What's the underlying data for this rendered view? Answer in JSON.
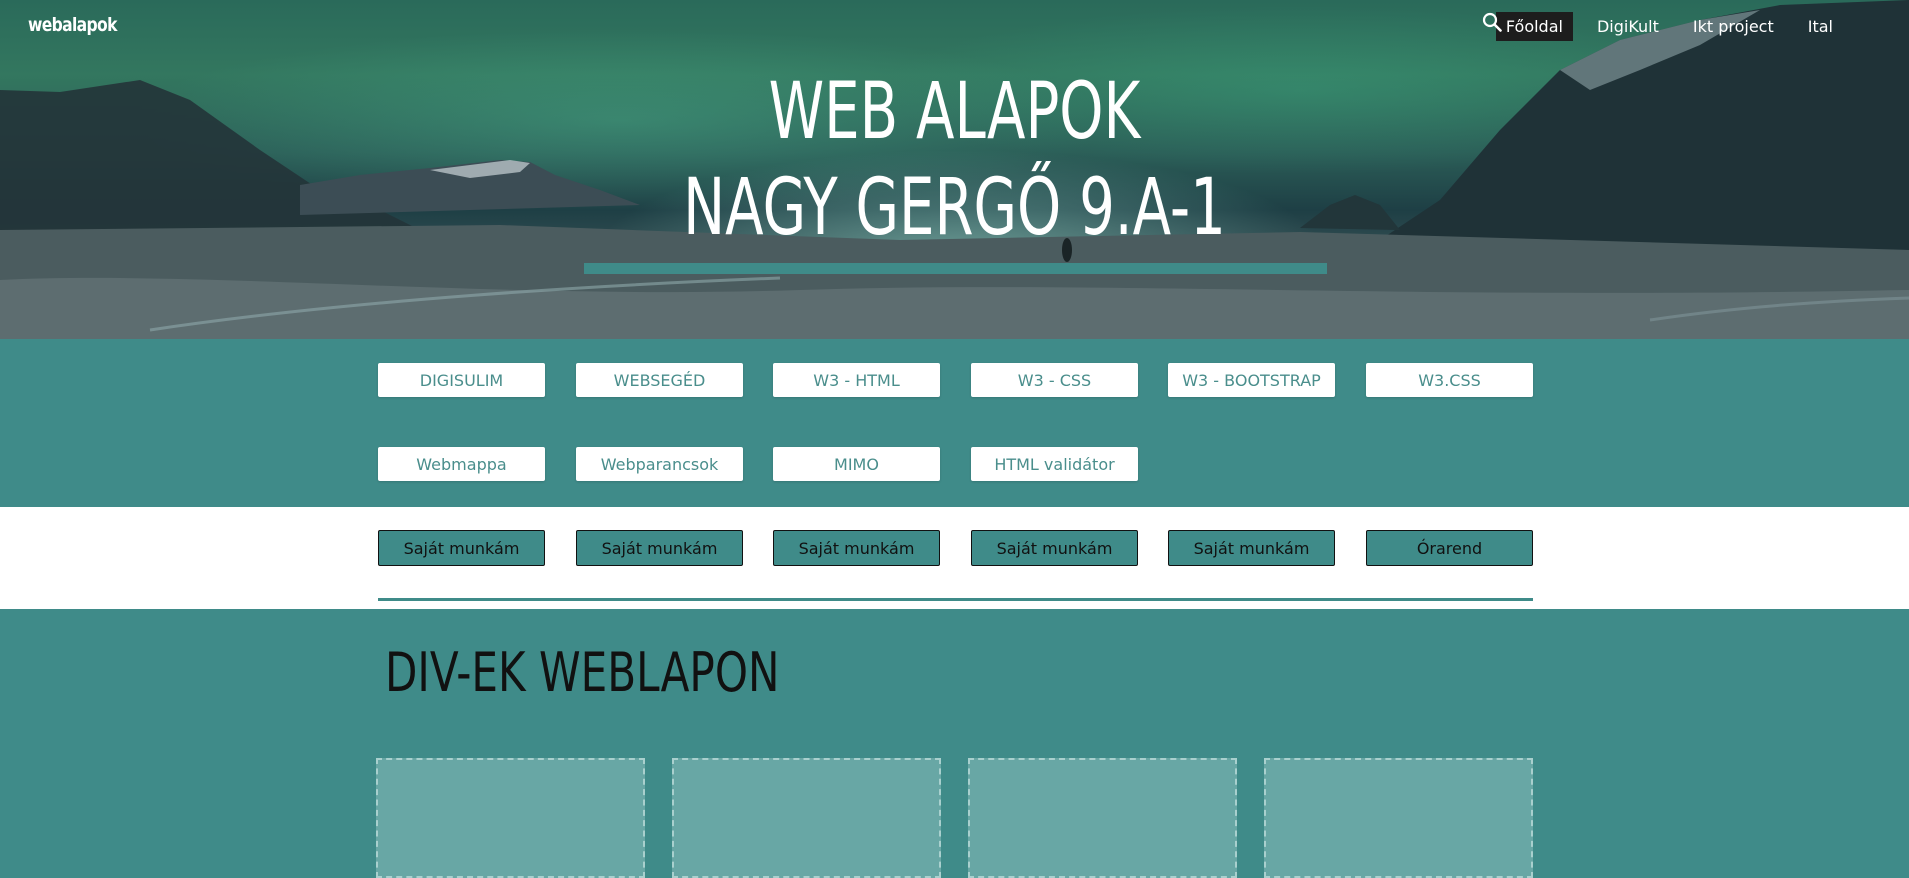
{
  "header": {
    "brand": "webalapok",
    "nav": [
      {
        "label": "Főoldal",
        "active": true
      },
      {
        "label": "DigiKult",
        "active": false
      },
      {
        "label": "Ikt project",
        "active": false
      },
      {
        "label": "Ital",
        "active": false
      }
    ],
    "search_icon": "search-icon"
  },
  "hero": {
    "title_line1": "WEB ALAPOK",
    "title_line2": "NAGY GERGŐ 9.A-1"
  },
  "links_row1": [
    "DIGISULIM",
    "WEBSEGÉD",
    "W3 - HTML",
    "W3 - CSS",
    "W3 - BOOTSTRAP",
    "W3.CSS"
  ],
  "links_row2": [
    "Webmappa",
    "Webparancsok",
    "MIMO",
    "HTML validátor"
  ],
  "work_buttons": [
    "Saját munkám",
    "Saját munkám",
    "Saját munkám",
    "Saját munkám",
    "Saját munkám",
    "Órarend"
  ],
  "section": {
    "title": "DIV-EK WEBLAPON"
  },
  "colors": {
    "teal": "#3f8b89",
    "box": "#68a7a5",
    "nav_active": "#1d1d1d"
  }
}
